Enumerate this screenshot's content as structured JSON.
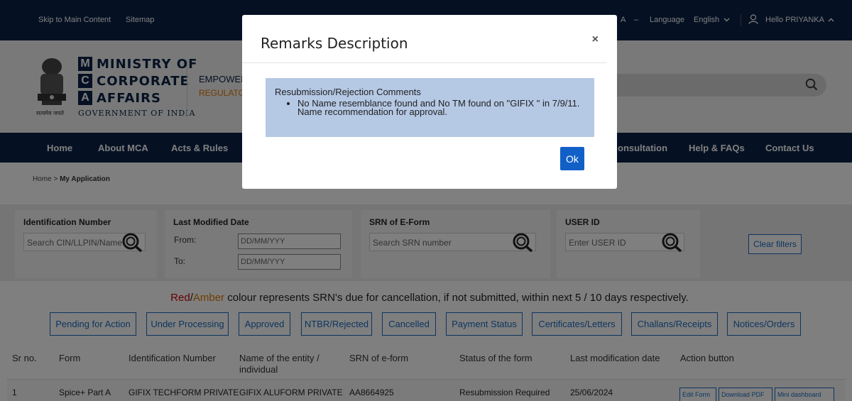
{
  "topbar": {
    "skip": "Skip to Main Content",
    "sitemap": "Sitemap",
    "font_size": "A",
    "font_dash": "–",
    "language_label": "Language",
    "language_value": "English",
    "user_greeting": "Hello PRIYANKA"
  },
  "header": {
    "mca_words": [
      "MINISTRY OF",
      "CORPORATE",
      "AFFAIRS"
    ],
    "mca_letters": [
      "M",
      "C",
      "A"
    ],
    "govt": "GOVERNMENT OF INDIA",
    "satyamev": "सत्यमेव जयते",
    "tagline1": "EMPOWER",
    "tagline2": "REGULATOR"
  },
  "nav": {
    "items": [
      "Home",
      "About MCA",
      "Acts & Rules",
      "onsultation",
      "Help & FAQs",
      "Contact Us"
    ]
  },
  "breadcrumb": {
    "home": "Home >",
    "current": "My Application"
  },
  "filters": {
    "identification": {
      "title": "Identification Number",
      "placeholder": "Search CIN/LLPIN/Name"
    },
    "modified": {
      "title": "Last Modified Date",
      "from_label": "From:",
      "to_label": "To:",
      "from_placeholder": "DD/MM/YYY",
      "to_placeholder": "DD/MM/YYY"
    },
    "srn": {
      "title": "SRN of E-Form",
      "placeholder": "Search SRN number"
    },
    "user": {
      "title": "USER ID",
      "placeholder": "Enter USER ID"
    },
    "clear": "Clear filters"
  },
  "legend": {
    "red": "Red",
    "slash": "/",
    "amber": "Amber",
    "rest": " colour represents SRN's due for cancellation, if not submitted, within next 5 / 10 days respectively."
  },
  "tabs": [
    "Pending for Action",
    "Under Processing",
    "Approved",
    "NTBR/Rejected",
    "Cancelled",
    "Payment Status",
    "Certificates/Letters",
    "Challans/Receipts",
    "Notices/Orders"
  ],
  "table": {
    "headers": [
      "Sr no.",
      "Form",
      "Identification Number",
      "Name of the entity / individual",
      "SRN of e-form",
      "Status of the form",
      "Last modification date",
      "Action button"
    ],
    "row": [
      "1",
      "Spice+ Part A",
      "GIFIX TECHFORM PRIVATE",
      "GIFIX ALUFORM PRIVATE",
      "AA8664925",
      "Resubmission Required",
      "25/06/2024"
    ],
    "actions": [
      "Edit Form",
      "Download PDF",
      "Mini dashboard"
    ]
  },
  "modal": {
    "title": "Remarks Description",
    "close": "×",
    "comment_heading": "Resubmission/Rejection Comments",
    "comments": [
      "No Name resemblance found and No TM found on \"GIFIX \" in 7/9/11. Name recommendation for approval."
    ],
    "ok": "Ok"
  },
  "colors": {
    "navy": "#0b2247",
    "accent": "#1a6bbf",
    "ok": "#1160c8",
    "remark_bg": "#b5c8e4",
    "red": "#d40000",
    "amber": "#e07b00"
  }
}
